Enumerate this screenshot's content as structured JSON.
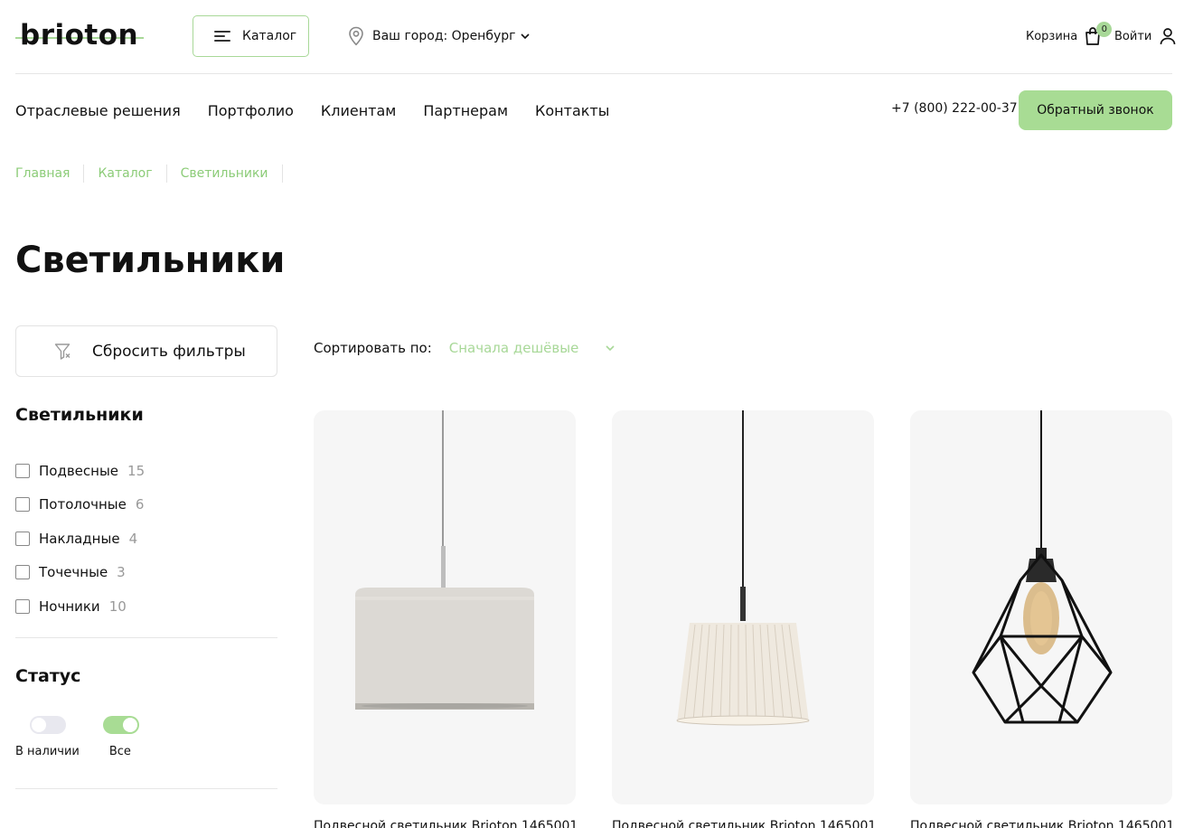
{
  "header": {
    "logo_text": "brioton",
    "catalog_label": "Каталог",
    "city_label": "Ваш город: Оренбург",
    "cart_label": "Корзина",
    "cart_count": "0",
    "login_label": "Войти"
  },
  "nav": {
    "items": [
      "Отраслевые решения",
      "Портфолио",
      "Клиентам",
      "Партнерам",
      "Контакты"
    ],
    "phone": "+7 (800) 222-00-37",
    "callback_label": "Обратный звонок"
  },
  "breadcrumbs": [
    "Главная",
    "Каталог",
    "Светильники"
  ],
  "page_title": "Светильники",
  "sidebar": {
    "reset_label": "Сбросить фильтры",
    "category_title": "Светильники",
    "categories": [
      {
        "label": "Подвесные",
        "count": "15"
      },
      {
        "label": "Потолочные",
        "count": "6"
      },
      {
        "label": "Накладные",
        "count": "4"
      },
      {
        "label": "Точечные",
        "count": "3"
      },
      {
        "label": "Ночники",
        "count": "10"
      }
    ],
    "status_title": "Статус",
    "status": [
      {
        "label": "В наличии",
        "on": false
      },
      {
        "label": "Все",
        "on": true
      }
    ]
  },
  "sort": {
    "label": "Сортировать по:",
    "value": "Сначала дешёвые"
  },
  "products": [
    {
      "title": "Подвесной светильник Brioton 1465001 ..."
    },
    {
      "title": "Подвесной светильник Brioton 1465001 ..."
    },
    {
      "title": "Подвесной светильник Brioton 1465001 ..."
    }
  ],
  "colors": {
    "accent": "#a8dc94",
    "accent_text": "#8ccc78",
    "card_bg": "#f6f6f6"
  }
}
